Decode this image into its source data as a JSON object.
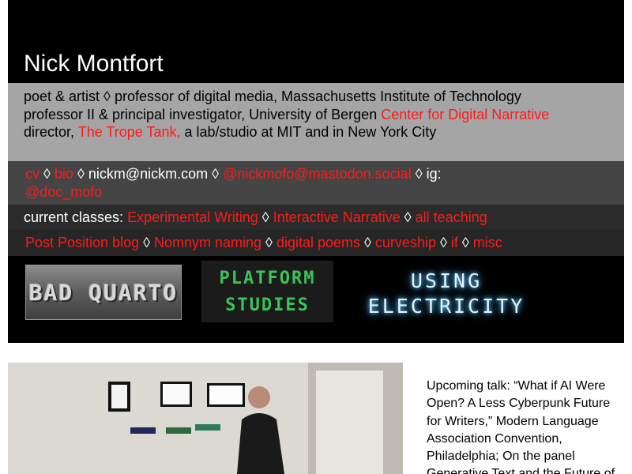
{
  "header": {
    "name": "Nick Montfort"
  },
  "about": {
    "line1": "poet & artist ◊ professor of digital media, Massachusetts Institute of Technology",
    "line2_prefix": "professor II & principal investigator, University of Bergen ",
    "line2_link": "Center for Digital Narrative",
    "line3_prefix": "director, ",
    "line3_link": "The Trope Tank,",
    "line3_suffix": " a lab/studio at MIT and in New York City"
  },
  "contact": {
    "cv": "cv",
    "bio": "bio",
    "email": "nickm@nickm.com",
    "mastodon": "@nickmofo@mastodon.social",
    "ig_label": "ig:",
    "instagram": "@doc_mofo",
    "separator": " ◊ "
  },
  "classes": {
    "label": "current classes:",
    "items": [
      "Experimental Writing",
      "Interactive Narrative",
      "all teaching"
    ]
  },
  "links": {
    "items": [
      "Post Position blog",
      "Nomnym naming",
      "digital poems",
      "curveship",
      "if",
      "misc"
    ]
  },
  "books": {
    "bad_quarto": "BAD QUARTO",
    "platform_line1": "PLATFORM",
    "platform_line2": "STUDIES",
    "electricity_line1": "USING",
    "electricity_line2": "ELECTRICITY"
  },
  "talk": {
    "text": "Upcoming talk: “What if AI Were Open? A Less Cyberpunk Future for Writers,” Modern Language Association Convention, Philadelphia; On the panel Generative Text and the Future of"
  },
  "colors": {
    "link": "#ff1a1a",
    "header_bg": "#000000",
    "about_bg": "#a5a5a5",
    "contact_bg": "#444444",
    "platform_green": "#39c45a"
  }
}
